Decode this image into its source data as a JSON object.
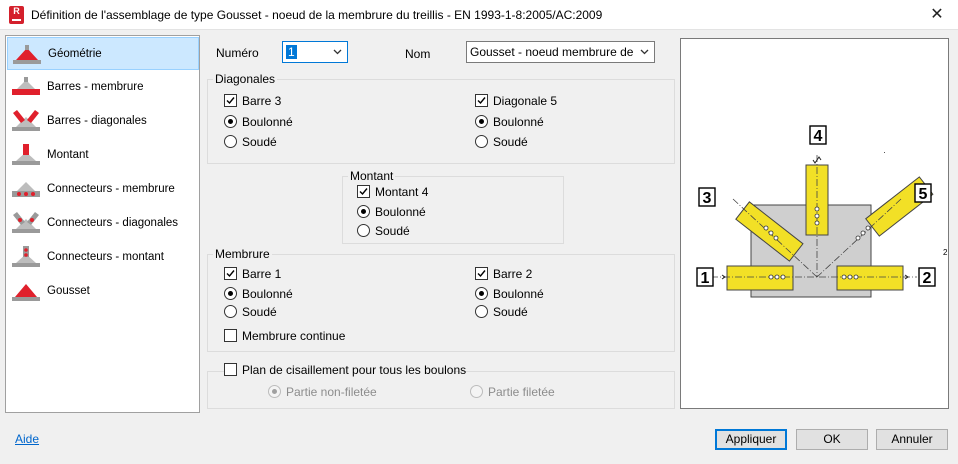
{
  "window": {
    "title": "Définition de l'assemblage de type Gousset - noeud de la membrure du treillis -  EN 1993-1-8:2005/AC:2009",
    "app_icon_letter": "R",
    "close_glyph": "✕"
  },
  "nav": {
    "items": [
      {
        "label": "Géométrie",
        "icon": "gusset-geometry-icon",
        "selected": true
      },
      {
        "label": "Barres - membrure",
        "icon": "chord-bars-icon"
      },
      {
        "label": "Barres - diagonales",
        "icon": "diagonal-bars-icon"
      },
      {
        "label": "Montant",
        "icon": "vertical-post-icon"
      },
      {
        "label": "Connecteurs - membrure",
        "icon": "chord-connectors-icon"
      },
      {
        "label": "Connecteurs - diagonales",
        "icon": "diagonal-connectors-icon"
      },
      {
        "label": "Connecteurs - montant",
        "icon": "post-connectors-icon"
      },
      {
        "label": "Gousset",
        "icon": "gusset-plate-icon"
      }
    ]
  },
  "form": {
    "numero_label": "Numéro",
    "numero_value": "1",
    "nom_label": "Nom",
    "nom_value": "Gousset - noeud membrure de treilli",
    "diagonales": {
      "label": "Diagonales",
      "left": {
        "check_label": "Barre 3",
        "checked": true,
        "radio1": "Boulonné",
        "radio2": "Soudé",
        "selected": 1
      },
      "right": {
        "check_label": "Diagonale 5",
        "checked": true,
        "radio1": "Boulonné",
        "radio2": "Soudé",
        "selected": 1
      }
    },
    "montant": {
      "label": "Montant",
      "check_label": "Montant 4",
      "checked": true,
      "radio1": "Boulonné",
      "radio2": "Soudé",
      "selected": 1
    },
    "membrure": {
      "label": "Membrure",
      "left": {
        "check_label": "Barre 1",
        "checked": true,
        "radio1": "Boulonné",
        "radio2": "Soudé",
        "selected": 1
      },
      "right": {
        "check_label": "Barre 2",
        "checked": true,
        "radio1": "Boulonné",
        "radio2": "Soudé",
        "selected": 1
      },
      "continuous_label": "Membrure continue",
      "continuous_checked": false
    },
    "shear": {
      "check_label": "Plan de cisaillement pour tous les boulons",
      "checked": false,
      "option1": "Partie non-filetée",
      "option2": "Partie filetée",
      "selected": 1
    }
  },
  "preview": {
    "labels": [
      "1",
      "2",
      "3",
      "4",
      "5"
    ],
    "member_color": "#f2e026",
    "plate_color": "#cfcfcf",
    "stray_mark": "2"
  },
  "footer": {
    "help_link": "Aide",
    "apply": "Appliquer",
    "ok": "OK",
    "cancel": "Annuler"
  },
  "colors": {
    "accent": "#0078d7",
    "icon_red": "#e0202c",
    "link": "#0066cc"
  }
}
